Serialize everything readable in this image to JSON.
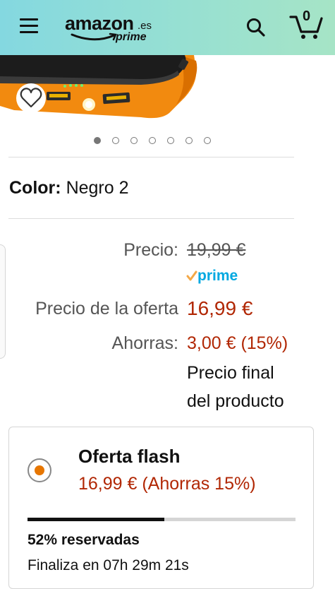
{
  "header": {
    "logo_text": "amazon",
    "logo_tld": ".es",
    "logo_sub": "prime",
    "cart_count": "0",
    "colors": {
      "gradient_start": "#84d8e0",
      "gradient_end": "#a6e4c6"
    }
  },
  "gallery": {
    "total_images": 7,
    "active_index": 0
  },
  "product": {
    "color_label": "Color:",
    "color_value": "Negro 2"
  },
  "pricing": {
    "list_price_label": "Precio:",
    "list_price": "19,99 €",
    "prime_label": "prime",
    "deal_label": "Precio de la oferta",
    "deal_price": "16,99 €",
    "savings_label": "Ahorras:",
    "savings_value": "3,00 € (15%)",
    "final_note_line1": "Precio final",
    "final_note_line2": "del producto",
    "colors": {
      "deal": "#b12704",
      "muted": "#555555"
    }
  },
  "flash_deal": {
    "title": "Oferta flash",
    "price_text": "16,99 € (Ahorras 15%)",
    "claimed_percent": 52,
    "claimed_text": "52% reservadas",
    "ends_text": "Finaliza en 07h 29m 21s",
    "selected": true,
    "colors": {
      "radio": "#e77600",
      "progress": "#111111"
    }
  },
  "icons": [
    "menu-icon",
    "search-icon",
    "cart-icon",
    "heart-icon",
    "prime-check-icon"
  ]
}
